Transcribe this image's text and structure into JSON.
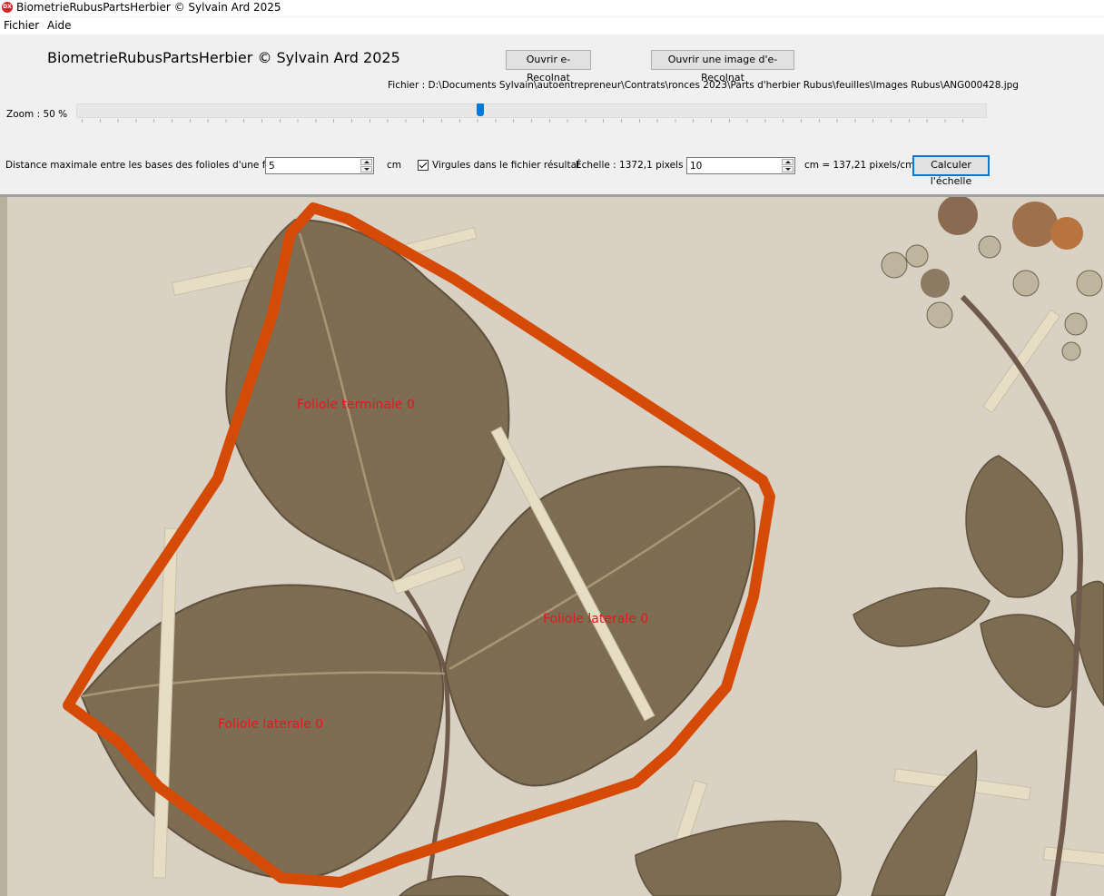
{
  "window": {
    "title": "BiometrieRubusPartsHerbier © Sylvain Ard 2025",
    "icon": "dx-app-icon"
  },
  "menu": {
    "items": [
      "Fichier",
      "Aide"
    ]
  },
  "header": {
    "title": "BiometrieRubusPartsHerbier © Sylvain Ard 2025",
    "btn_open_erecolnat": "Ouvrir e-Recolnat",
    "btn_open_image": "Ouvrir une image d'e-Recolnat",
    "file_path": "Fichier : D:\\Documents Sylvain\\autoentrepreneur\\Contrats\\ronces 2023\\Parts d'herbier Rubus\\feuilles\\Images Rubus\\ANG000428.jpg"
  },
  "zoom": {
    "label": "Zoom : 50 %",
    "value_percent": 50
  },
  "params": {
    "distance_label": "Distance maximale entre les bases des folioles d'une feuille",
    "distance_value": "5",
    "distance_unit": "cm",
    "virgules_label": "Virgules dans le fichier résultat",
    "virgules_checked": true,
    "echelle_label": "Échelle :  1372,1 pixels /",
    "echelle_value": "10",
    "echelle_result": "cm = 137,21 pixels/cm",
    "btn_calc": "Calculer l'échelle"
  },
  "image": {
    "labels": [
      "Foliole terminale 0",
      "Foliole laterale 0",
      "Foliole laterale 0"
    ],
    "colors": {
      "paper": "#d9d1c3",
      "leaf": "#7c6c52",
      "outline": "#d44a06",
      "label": "#e8161f",
      "tape": "#e6ddc4"
    }
  }
}
